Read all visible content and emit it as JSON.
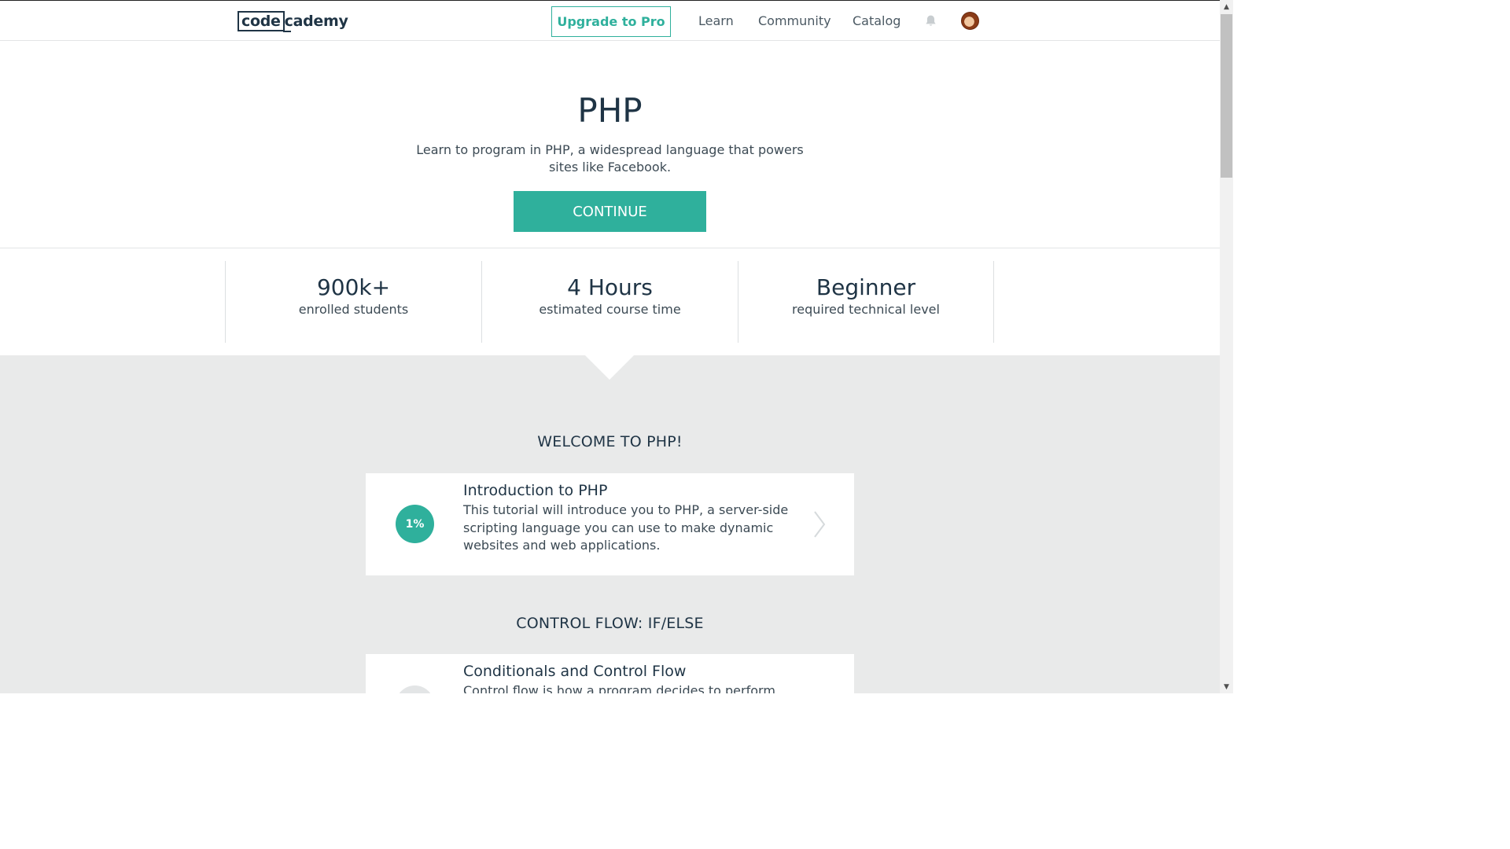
{
  "nav": {
    "logo_box": "code",
    "logo_rest": "cademy",
    "upgrade_label": "Upgrade to Pro",
    "links": [
      "Learn",
      "Community",
      "Catalog"
    ],
    "notifications_icon": "bell-icon",
    "avatar_icon": "user-avatar"
  },
  "hero": {
    "title": "PHP",
    "description": "Learn to program in PHP, a widespread language that powers sites like Facebook.",
    "continue_label": "CONTINUE"
  },
  "stats": [
    {
      "value": "900k+",
      "label": "enrolled students"
    },
    {
      "value": "4 Hours",
      "label": "estimated course time"
    },
    {
      "value": "Beginner",
      "label": "required technical level"
    }
  ],
  "syllabus": [
    {
      "section": "WELCOME TO PHP!",
      "card_title": "Introduction to PHP",
      "card_desc": "This tutorial will introduce you to PHP, a server-side scripting language you can use to make dynamic websites and web applications.",
      "progress": "1%"
    },
    {
      "section": "CONTROL FLOW: IF/ELSE",
      "card_title": "Conditionals and Control Flow",
      "card_desc": "Control flow is how a program decides to perform one",
      "progress": ""
    }
  ],
  "colors": {
    "accent": "#2fb09c",
    "text_dark": "#1f3445",
    "syllabus_bg": "#e9eaea"
  }
}
